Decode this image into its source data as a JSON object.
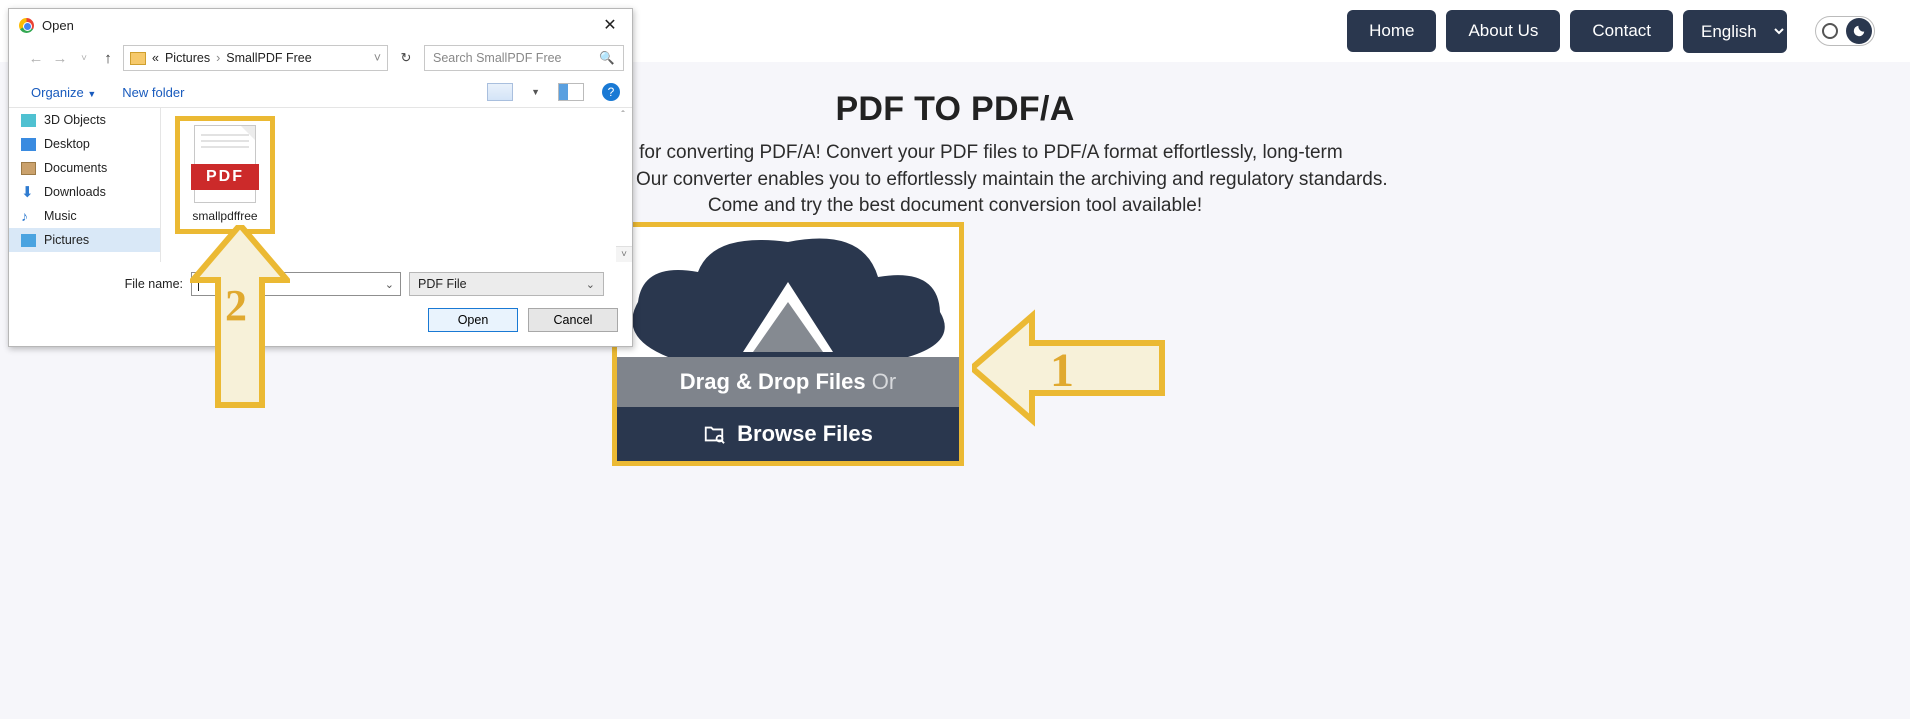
{
  "nav": {
    "home": "Home",
    "about": "About Us",
    "contact": "Contact",
    "language": "English"
  },
  "page": {
    "title": "PDF TO PDF/A",
    "desc": "ced tool for converting PDF/A! Convert your PDF files to PDF/A format effortlessly, long-term compatibility. Our converter enables you to effortlessly maintain the archiving and regulatory standards. Come and try the best document conversion tool available!"
  },
  "drop": {
    "drag": "Drag & Drop Files",
    "or": "Or",
    "browse": "Browse Files"
  },
  "arrows": {
    "one": "1",
    "two": "2"
  },
  "dialog": {
    "title": "Open",
    "breadcrumb": {
      "prefix": "«",
      "p1": "Pictures",
      "p2": "SmallPDF Free"
    },
    "search_placeholder": "Search SmallPDF Free",
    "toolbar": {
      "organize": "Organize",
      "newfolder": "New folder",
      "help": "?"
    },
    "sidebar": {
      "items": [
        {
          "label": "3D Objects"
        },
        {
          "label": "Desktop"
        },
        {
          "label": "Documents"
        },
        {
          "label": "Downloads"
        },
        {
          "label": "Music"
        },
        {
          "label": "Pictures"
        }
      ]
    },
    "file": {
      "badge": "PDF",
      "name": "smallpdffree"
    },
    "filename_label": "File name:",
    "filename_value": "",
    "filetype": "PDF File",
    "open": "Open",
    "cancel": "Cancel"
  }
}
